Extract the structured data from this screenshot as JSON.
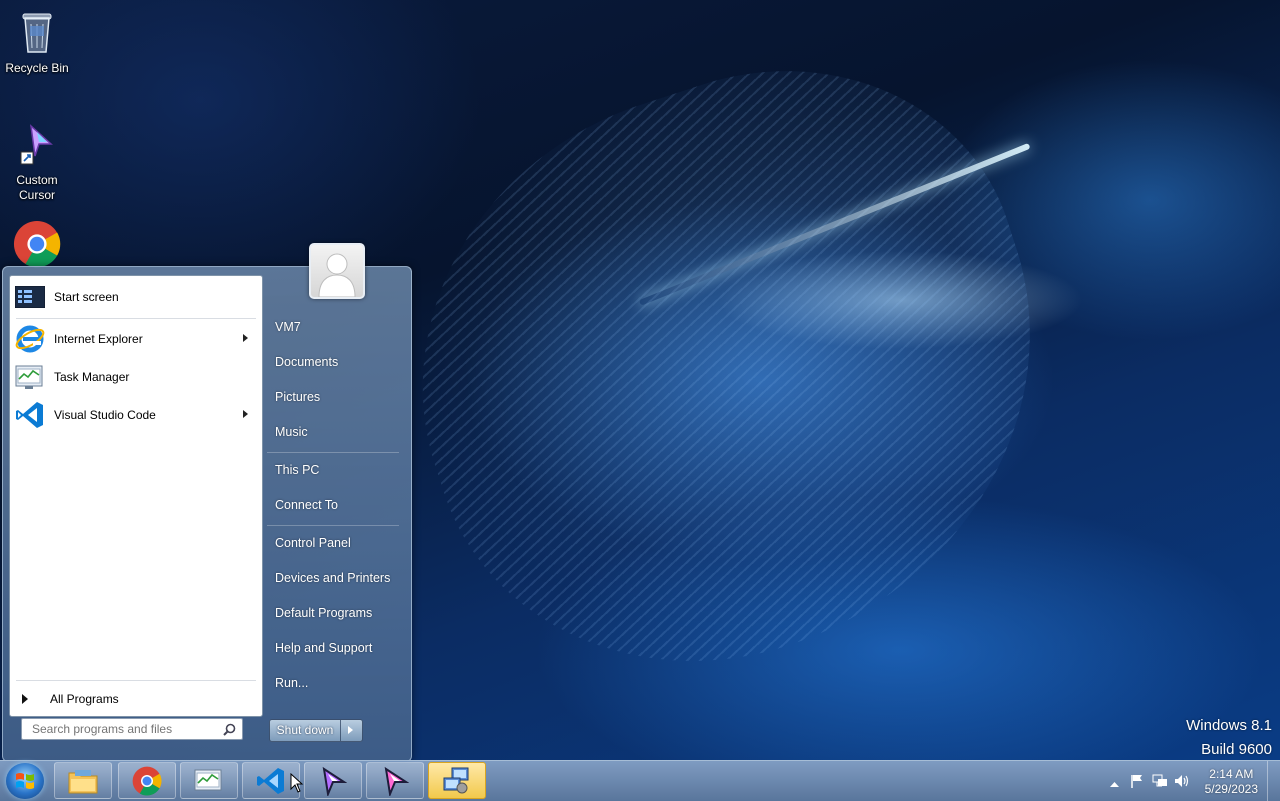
{
  "desktop": {
    "icons": [
      {
        "label": "Recycle Bin",
        "icon": "recycle-bin-icon"
      },
      {
        "label": "Custom\nCursor",
        "icon": "cursor-shortcut-icon"
      },
      {
        "label": "",
        "icon": "chrome-icon"
      }
    ],
    "watermark": {
      "line1": "Windows 8.1",
      "line2": "Build 9600"
    }
  },
  "start_menu": {
    "pinned": [
      {
        "label": "Start screen",
        "icon": "start-screen-icon",
        "has_submenu": false
      },
      {
        "label": "Internet Explorer",
        "icon": "internet-explorer-icon",
        "has_submenu": true
      },
      {
        "label": "Task Manager",
        "icon": "task-manager-icon",
        "has_submenu": false
      },
      {
        "label": "Visual Studio Code",
        "icon": "vscode-icon",
        "has_submenu": true
      }
    ],
    "all_programs": "All Programs",
    "search_placeholder": "Search programs and files",
    "user_name": "VM7",
    "right_items": [
      "Documents",
      "Pictures",
      "Music",
      "This PC",
      "Connect To",
      "Control Panel",
      "Devices and Printers",
      "Default Programs",
      "Help and Support",
      "Run..."
    ],
    "shutdown_label": "Shut down"
  },
  "taskbar": {
    "buttons": [
      {
        "icon": "file-explorer-icon",
        "active": false
      },
      {
        "icon": "chrome-icon",
        "active": false
      },
      {
        "icon": "task-manager-icon",
        "active": false
      },
      {
        "icon": "vscode-icon",
        "active": false
      },
      {
        "icon": "custom-cursor-icon",
        "active": false
      },
      {
        "icon": "custom-cursor-icon",
        "active": false
      },
      {
        "icon": "network-config-icon",
        "active": true
      }
    ],
    "tray_icons": [
      "show-hidden-icons",
      "action-center-flag-icon",
      "network-icon",
      "volume-icon"
    ],
    "clock_time": "2:14 AM",
    "clock_date": "5/29/2023"
  },
  "colors": {
    "accent": "#2a74c8",
    "menu_glass": "#6f8fb3",
    "active_taskbar": "#f2c94c"
  }
}
